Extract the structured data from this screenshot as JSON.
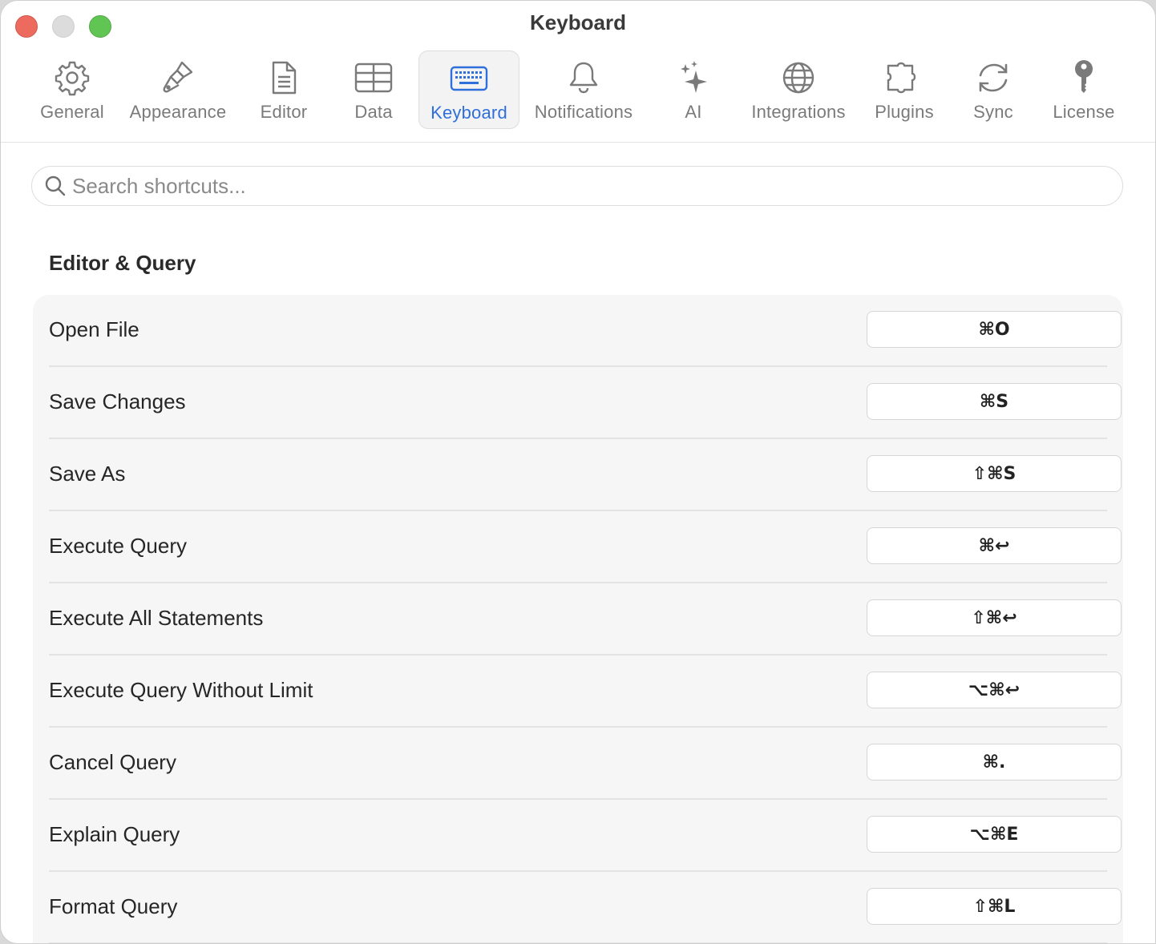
{
  "window": {
    "title": "Keyboard"
  },
  "tabs": [
    {
      "label": "General",
      "icon": "gear-icon"
    },
    {
      "label": "Appearance",
      "icon": "paintbrush-icon"
    },
    {
      "label": "Editor",
      "icon": "document-icon"
    },
    {
      "label": "Data",
      "icon": "table-icon"
    },
    {
      "label": "Keyboard",
      "icon": "keyboard-icon",
      "active": true
    },
    {
      "label": "Notifications",
      "icon": "bell-icon"
    },
    {
      "label": "AI",
      "icon": "sparkles-icon"
    },
    {
      "label": "Integrations",
      "icon": "globe-icon"
    },
    {
      "label": "Plugins",
      "icon": "puzzle-icon"
    },
    {
      "label": "Sync",
      "icon": "sync-icon"
    },
    {
      "label": "License",
      "icon": "key-icon"
    }
  ],
  "search": {
    "placeholder": "Search shortcuts..."
  },
  "section": {
    "title": "Editor & Query"
  },
  "shortcuts": [
    {
      "name": "Open File",
      "keys": "⌘O"
    },
    {
      "name": "Save Changes",
      "keys": "⌘S"
    },
    {
      "name": "Save As",
      "keys": "⇧⌘S"
    },
    {
      "name": "Execute Query",
      "keys": "⌘↩"
    },
    {
      "name": "Execute All Statements",
      "keys": "⇧⌘↩"
    },
    {
      "name": "Execute Query Without Limit",
      "keys": "⌥⌘↩"
    },
    {
      "name": "Cancel Query",
      "keys": "⌘."
    },
    {
      "name": "Explain Query",
      "keys": "⌥⌘E"
    },
    {
      "name": "Format Query",
      "keys": "⇧⌘L"
    }
  ],
  "colors": {
    "accent": "#2f6fdc",
    "tab_text": "#7a7a7a",
    "card_bg": "#f6f6f6"
  }
}
